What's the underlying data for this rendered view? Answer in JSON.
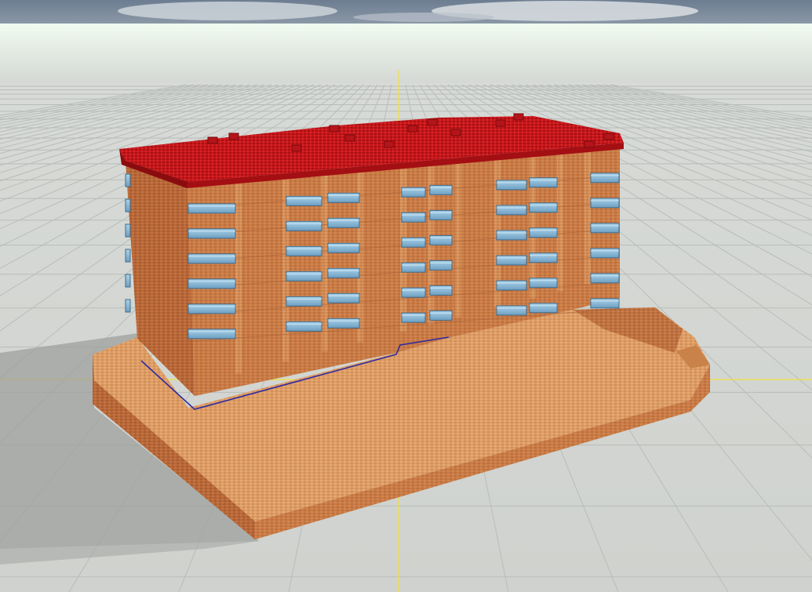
{
  "scene": {
    "type": "3d-viewport",
    "subject": "building-model",
    "colors": {
      "sky_top": "#6f7f93",
      "sky_cloud": "#d9dde2",
      "horizon_glow": "#eefaee",
      "ground": "#d2d4d1",
      "grid_line": "#bfc3c0",
      "axis_line": "#f2e24a",
      "roof": "#c8171b",
      "roof_dark": "#8e0d10",
      "wall": "#c87a45",
      "wall_shadow": "#a85f33",
      "pilaster": "#d89a68",
      "podium_top": "#e3a26a",
      "podium_side": "#c07240",
      "glass": "#8fc0dc",
      "glass_frame": "#4f7d9c",
      "outline": "#2a2a9a",
      "shadow": "#9c9e9c"
    },
    "building": {
      "floors": 6,
      "balcony_columns": 8
    }
  }
}
